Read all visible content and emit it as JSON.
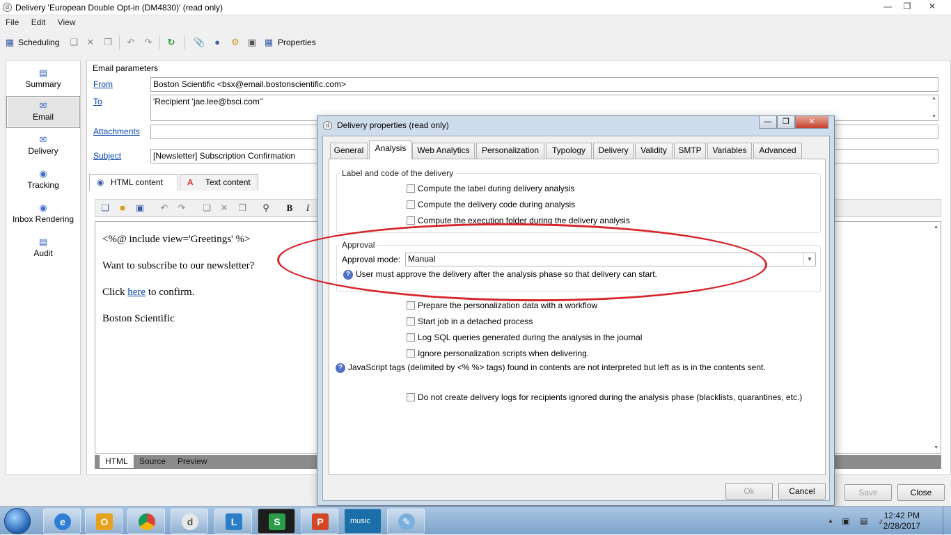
{
  "window": {
    "title": "Delivery 'European Double Opt-in (DM4830)' (read only)"
  },
  "menu": [
    "File",
    "Edit",
    "View"
  ],
  "toolbar": {
    "scheduling": "Scheduling",
    "properties": "Properties"
  },
  "nav": [
    "Summary",
    "Email",
    "Delivery",
    "Tracking",
    "Inbox Rendering",
    "Audit"
  ],
  "email_params": {
    "section": "Email parameters",
    "from_label": "From",
    "from_value": "Boston Scientific <bsx@email.bostonscientific.com>",
    "to_label": "To",
    "to_value": "'Recipient 'jae.lee@bsci.com''",
    "attachments_label": "Attachments",
    "subject_label": "Subject",
    "subject_value": "[Newsletter] Subscription Confirmation"
  },
  "content_tabs": [
    "HTML content",
    "Text content"
  ],
  "editor": {
    "line1": "<%@ include view='Greetings' %>",
    "line2": "Want to subscribe to our newsletter?",
    "line3_pre": "Click ",
    "line3_link": "here",
    "line3_post": " to confirm.",
    "line4": "Boston Scientific",
    "bold": "B",
    "italic": "I"
  },
  "bottom_tabs": [
    "HTML",
    "Source",
    "Preview"
  ],
  "main_buttons": {
    "save": "Save",
    "close": "Close"
  },
  "dialog": {
    "title": "Delivery properties (read only)",
    "tabs": [
      "General",
      "Analysis",
      "Web Analytics",
      "Personalization",
      "Typology",
      "Delivery",
      "Validity",
      "SMTP",
      "Variables",
      "Advanced"
    ],
    "label_group": "Label and code of the delivery",
    "cb_label": "Compute the label during delivery analysis",
    "cb_code": "Compute the delivery code during analysis",
    "cb_folder": "Compute the execution folder during the delivery analysis",
    "approval_group": "Approval",
    "approval_mode_label": "Approval mode:",
    "approval_mode_value": "Manual",
    "approval_info": "User must approve the delivery after the analysis phase so that delivery can start.",
    "cb_prepare": "Prepare the personalization data with a workflow",
    "cb_detached": "Start job in a detached process",
    "cb_logsql": "Log SQL queries generated during the analysis in the journal",
    "cb_ignore": "Ignore personalization scripts when delivering.",
    "js_info": "JavaScript tags (delimited by <% %> tags) found in contents are not interpreted but left as is in the contents sent.",
    "cb_nolog": "Do not create delivery logs for recipients ignored during the analysis phase (blacklists, quarantines, etc.)",
    "ok": "Ok",
    "cancel": "Cancel"
  },
  "taskbar": {
    "time": "12:42 PM",
    "date": "2/28/2017",
    "music_label": "music"
  },
  "colors": {
    "highlight_ellipse": "#d7262b",
    "link": "#0645ad",
    "dialog_frame": "#cfdcec"
  }
}
